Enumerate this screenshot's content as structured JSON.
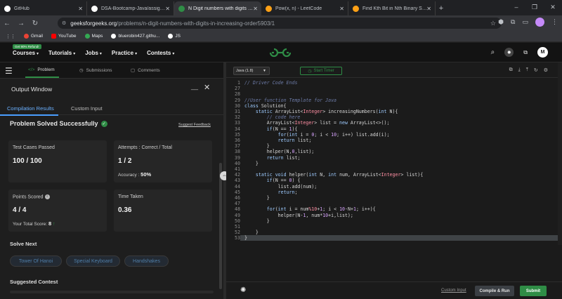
{
  "browser": {
    "tabs": [
      {
        "label": "GitHub",
        "icon": "github-icon",
        "color": "#ffffff"
      },
      {
        "label": "DSA-Bootcamp-Java/assignme",
        "icon": "github-icon",
        "color": "#ffffff"
      },
      {
        "label": "N Digit numbers with digits in i",
        "icon": "gfg-icon",
        "color": "#2f8d46",
        "active": true
      },
      {
        "label": "Pow(x, n) - LeetCode",
        "icon": "leetcode-icon",
        "color": "#ffa116"
      },
      {
        "label": "Find Kth Bit in Nth Binary String",
        "icon": "leetcode-icon",
        "color": "#ffa116"
      }
    ],
    "new_tab": "+",
    "window_controls": [
      "–",
      "❐",
      "✕"
    ],
    "url_host": "geeksforgeeks.org",
    "url_path": "/problems/n-digit-numbers-with-digits-in-increasing-order5903/1",
    "bookmarks": [
      {
        "label": "Gmail",
        "color": "#ea4335"
      },
      {
        "label": "YouTube",
        "color": "#ff0000"
      },
      {
        "label": "Maps",
        "color": "#34a853"
      },
      {
        "label": "bluerobin427.githu...",
        "color": "#ffffff"
      },
      {
        "label": "JS",
        "color": "#ffffff"
      }
    ]
  },
  "gfg": {
    "promo": "Get 90% Refund!",
    "menu": [
      "Courses",
      "Tutorials",
      "Jobs",
      "Practice",
      "Contests"
    ],
    "avatar_letter": "M",
    "brand_color": "#2f8d46"
  },
  "left": {
    "tabs": {
      "problem": "Problem",
      "submissions": "Submissions",
      "comments": "Comments"
    },
    "output_title": "Output Window",
    "output_tabs": {
      "compile": "Compilation Results",
      "custom": "Custom Input"
    },
    "status": "Problem Solved Successfully",
    "suggest_feedback": "Suggest Feedback",
    "cards": {
      "tests_label": "Test Cases Passed",
      "tests_value": "100 / 100",
      "attempts_label": "Attempts : Correct / Total",
      "attempts_value": "1 / 2",
      "accuracy_label": "Accuracy :",
      "accuracy_value": "50%",
      "points_label": "Points Scored",
      "points_value": "4 / 4",
      "total_label": "Your Total Score:",
      "total_value": "8",
      "time_label": "Time Taken",
      "time_value": "0.36"
    },
    "solve_next": "Solve Next",
    "chips": [
      "Tower Of Hanoi",
      "Special Keyboard",
      "Handshakes"
    ],
    "suggested_contest": "Suggested Contest"
  },
  "editor": {
    "language": "Java (1.8)",
    "start_timer": "Start Timer",
    "custom_input": "Custom Input",
    "compile_run": "Compile & Run",
    "submit": "Submit",
    "lines": [
      {
        "n": "1",
        "html": "<span class=\"cm\">// Driver Code Ends</span>"
      },
      {
        "n": "27",
        "html": ""
      },
      {
        "n": "28",
        "html": ""
      },
      {
        "n": "29",
        "html": "<span class=\"cm\">//User function Template for Java</span>"
      },
      {
        "n": "30",
        "html": "<span class=\"kw\">class</span> Solution{"
      },
      {
        "n": "31",
        "html": "    <span class=\"kw\">static</span> ArrayList&lt;<span class=\"ty\">Integer</span>&gt; increasingNumbers(<span class=\"kw\">int</span> N){"
      },
      {
        "n": "32",
        "html": "        <span class=\"cm\">// code here</span>"
      },
      {
        "n": "33",
        "html": "        ArrayList&lt;<span class=\"ty\">Integer</span>&gt; list = <span class=\"kw\">new</span> ArrayList&lt;&gt;();"
      },
      {
        "n": "34",
        "html": "        <span class=\"kw\">if</span>(N == <span class=\"num\">1</span>){"
      },
      {
        "n": "35",
        "html": "            <span class=\"kw\">for</span>(<span class=\"kw\">int</span> i = <span class=\"num\">0</span>; i &lt; <span class=\"num\">10</span>; i++) list.add(i);"
      },
      {
        "n": "36",
        "html": "            <span class=\"kw\">return</span> list;"
      },
      {
        "n": "37",
        "html": "        }"
      },
      {
        "n": "38",
        "html": "        helper(N,<span class=\"num\">0</span>,list);"
      },
      {
        "n": "39",
        "html": "        <span class=\"kw\">return</span> list;"
      },
      {
        "n": "40",
        "html": "    }"
      },
      {
        "n": "41",
        "html": ""
      },
      {
        "n": "42",
        "html": "    <span class=\"kw\">static</span> <span class=\"kw\">void</span> helper(<span class=\"kw\">int</span> N, <span class=\"kw\">int</span> num, ArrayList&lt;<span class=\"ty\">Integer</span>&gt; list){"
      },
      {
        "n": "43",
        "html": "        <span class=\"kw\">if</span>(N == <span class=\"num\">0</span>) {"
      },
      {
        "n": "44",
        "html": "            list.add(num);"
      },
      {
        "n": "45",
        "html": "            <span class=\"kw\">return</span>;"
      },
      {
        "n": "46",
        "html": "        }"
      },
      {
        "n": "47",
        "html": ""
      },
      {
        "n": "48",
        "html": "        <span class=\"kw\">for</span>(<span class=\"kw\">int</span> i = num<span class=\"ty\">%10</span>+<span class=\"num\">1</span>; i &lt; <span class=\"num\">10</span>-N+<span class=\"num\">1</span>; i++){"
      },
      {
        "n": "49",
        "html": "            helper(N-<span class=\"num\">1</span>, num*<span class=\"num\">10</span>+i,list);"
      },
      {
        "n": "50",
        "html": "        }"
      },
      {
        "n": "51",
        "html": ""
      },
      {
        "n": "52",
        "html": "    }"
      },
      {
        "n": "53",
        "html": "}"
      }
    ]
  }
}
